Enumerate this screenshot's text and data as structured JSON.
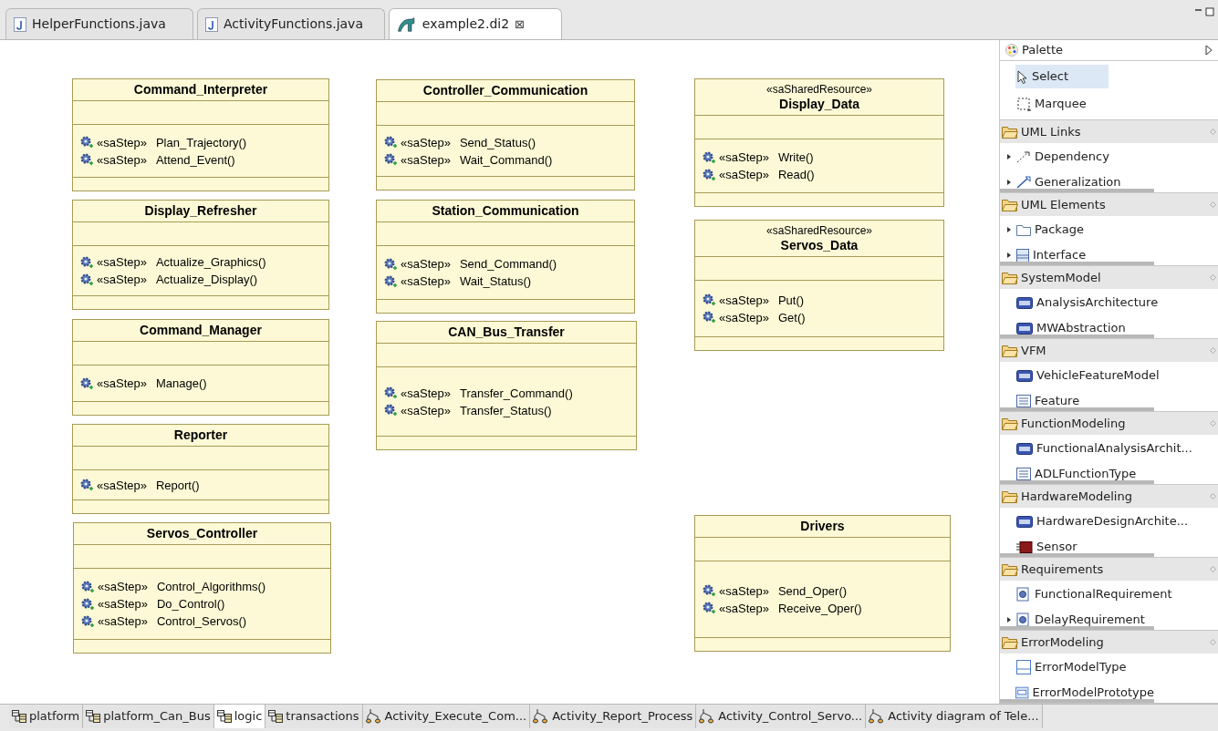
{
  "editor_tabs": [
    {
      "label": "HelperFunctions.java",
      "kind": "java",
      "selected": false
    },
    {
      "label": "ActivityFunctions.java",
      "kind": "java",
      "selected": false
    },
    {
      "label": "example2.di2",
      "kind": "diagram",
      "selected": true,
      "close": "⊠"
    }
  ],
  "classes": [
    {
      "name": "Command_Interpreter",
      "operations": [
        {
          "stereotype": "«saStep»",
          "name": "Plan_Trajectory()"
        },
        {
          "stereotype": "«saStep»",
          "name": "Attend_Event()"
        }
      ]
    },
    {
      "name": "Display_Refresher",
      "operations": [
        {
          "stereotype": "«saStep»",
          "name": "Actualize_Graphics()"
        },
        {
          "stereotype": "«saStep»",
          "name": "Actualize_Display()"
        }
      ]
    },
    {
      "name": "Command_Manager",
      "operations": [
        {
          "stereotype": "«saStep»",
          "name": "Manage()"
        }
      ]
    },
    {
      "name": "Reporter",
      "operations": [
        {
          "stereotype": "«saStep»",
          "name": "Report()"
        }
      ]
    },
    {
      "name": "Servos_Controller",
      "operations": [
        {
          "stereotype": "«saStep»",
          "name": "Control_Algorithms()"
        },
        {
          "stereotype": "«saStep»",
          "name": "Do_Control()"
        },
        {
          "stereotype": "«saStep»",
          "name": "Control_Servos()"
        }
      ]
    },
    {
      "name": "Controller_Communication",
      "operations": [
        {
          "stereotype": "«saStep»",
          "name": "Send_Status()"
        },
        {
          "stereotype": "«saStep»",
          "name": "Wait_Command()"
        }
      ]
    },
    {
      "name": "Station_Communication",
      "operations": [
        {
          "stereotype": "«saStep»",
          "name": "Send_Command()"
        },
        {
          "stereotype": "«saStep»",
          "name": "Wait_Status()"
        }
      ]
    },
    {
      "name": "CAN_Bus_Transfer",
      "operations": [
        {
          "stereotype": "«saStep»",
          "name": "Transfer_Command()"
        },
        {
          "stereotype": "«saStep»",
          "name": "Transfer_Status()"
        }
      ]
    },
    {
      "stereotype": "«saSharedResource»",
      "name": "Display_Data",
      "operations": [
        {
          "stereotype": "«saStep»",
          "name": "Write()"
        },
        {
          "stereotype": "«saStep»",
          "name": "Read()"
        }
      ]
    },
    {
      "stereotype": "«saSharedResource»",
      "name": "Servos_Data",
      "operations": [
        {
          "stereotype": "«saStep»",
          "name": "Put()"
        },
        {
          "stereotype": "«saStep»",
          "name": "Get()"
        }
      ]
    },
    {
      "name": "Drivers",
      "operations": [
        {
          "stereotype": "«saStep»",
          "name": "Send_Oper()"
        },
        {
          "stereotype": "«saStep»",
          "name": "Receive_Oper()"
        }
      ]
    }
  ],
  "palette": {
    "title": "Palette",
    "tools": [
      {
        "label": "Select",
        "kind": "select",
        "selected": true
      },
      {
        "label": "Marquee",
        "kind": "marquee",
        "selected": false
      }
    ],
    "groups": [
      {
        "label": "UML Links",
        "items": [
          {
            "label": "Dependency",
            "kind": "dependency",
            "expandable": true,
            "truncated": false
          },
          {
            "label": "Generalization",
            "kind": "generalization",
            "expandable": true,
            "truncated": true
          }
        ]
      },
      {
        "label": "UML Elements",
        "items": [
          {
            "label": "Package",
            "kind": "package",
            "expandable": true,
            "truncated": false
          },
          {
            "label": "Interface",
            "kind": "interface",
            "expandable": true,
            "truncated": true
          }
        ]
      },
      {
        "label": "SystemModel",
        "items": [
          {
            "label": "AnalysisArchitecture",
            "kind": "badge",
            "expandable": false,
            "truncated": false
          },
          {
            "label": "MWAbstraction",
            "kind": "badge",
            "expandable": false,
            "truncated": true
          }
        ]
      },
      {
        "label": "VFM",
        "items": [
          {
            "label": "VehicleFeatureModel",
            "kind": "badge",
            "expandable": false,
            "truncated": false
          },
          {
            "label": "Feature",
            "kind": "list",
            "expandable": false,
            "truncated": true
          }
        ]
      },
      {
        "label": "FunctionModeling",
        "items": [
          {
            "label": "FunctionalAnalysisArchit...",
            "kind": "badge",
            "expandable": false,
            "truncated": false
          },
          {
            "label": "ADLFunctionType",
            "kind": "list",
            "expandable": false,
            "truncated": true
          }
        ]
      },
      {
        "label": "HardwareModeling",
        "items": [
          {
            "label": "HardwareDesignArchite...",
            "kind": "badge",
            "expandable": false,
            "truncated": false
          },
          {
            "label": "Sensor",
            "kind": "sensor",
            "expandable": false,
            "truncated": true
          }
        ]
      },
      {
        "label": "Requirements",
        "items": [
          {
            "label": "FunctionalRequirement",
            "kind": "requirement",
            "expandable": false,
            "truncated": false
          },
          {
            "label": "DelayRequirement",
            "kind": "requirement",
            "expandable": true,
            "truncated": true
          }
        ]
      },
      {
        "label": "ErrorModeling",
        "items": [
          {
            "label": "ErrorModelType",
            "kind": "errortype",
            "expandable": false,
            "truncated": false
          },
          {
            "label": "ErrorModelPrototype",
            "kind": "errorproto",
            "expandable": false,
            "truncated": true
          }
        ]
      }
    ]
  },
  "diagram_tabs": [
    {
      "label": "platform",
      "kind": "class",
      "selected": false
    },
    {
      "label": "platform_Can_Bus",
      "kind": "class",
      "selected": false
    },
    {
      "label": "logic",
      "kind": "class",
      "selected": true
    },
    {
      "label": "transactions",
      "kind": "class",
      "selected": false
    },
    {
      "label": "Activity_Execute_Com...",
      "kind": "activity",
      "selected": false
    },
    {
      "label": "Activity_Report_Process",
      "kind": "activity",
      "selected": false
    },
    {
      "label": "Activity_Control_Servo...",
      "kind": "activity",
      "selected": false
    },
    {
      "label": "Activity diagram of Tele...",
      "kind": "activity",
      "selected": false
    }
  ]
}
